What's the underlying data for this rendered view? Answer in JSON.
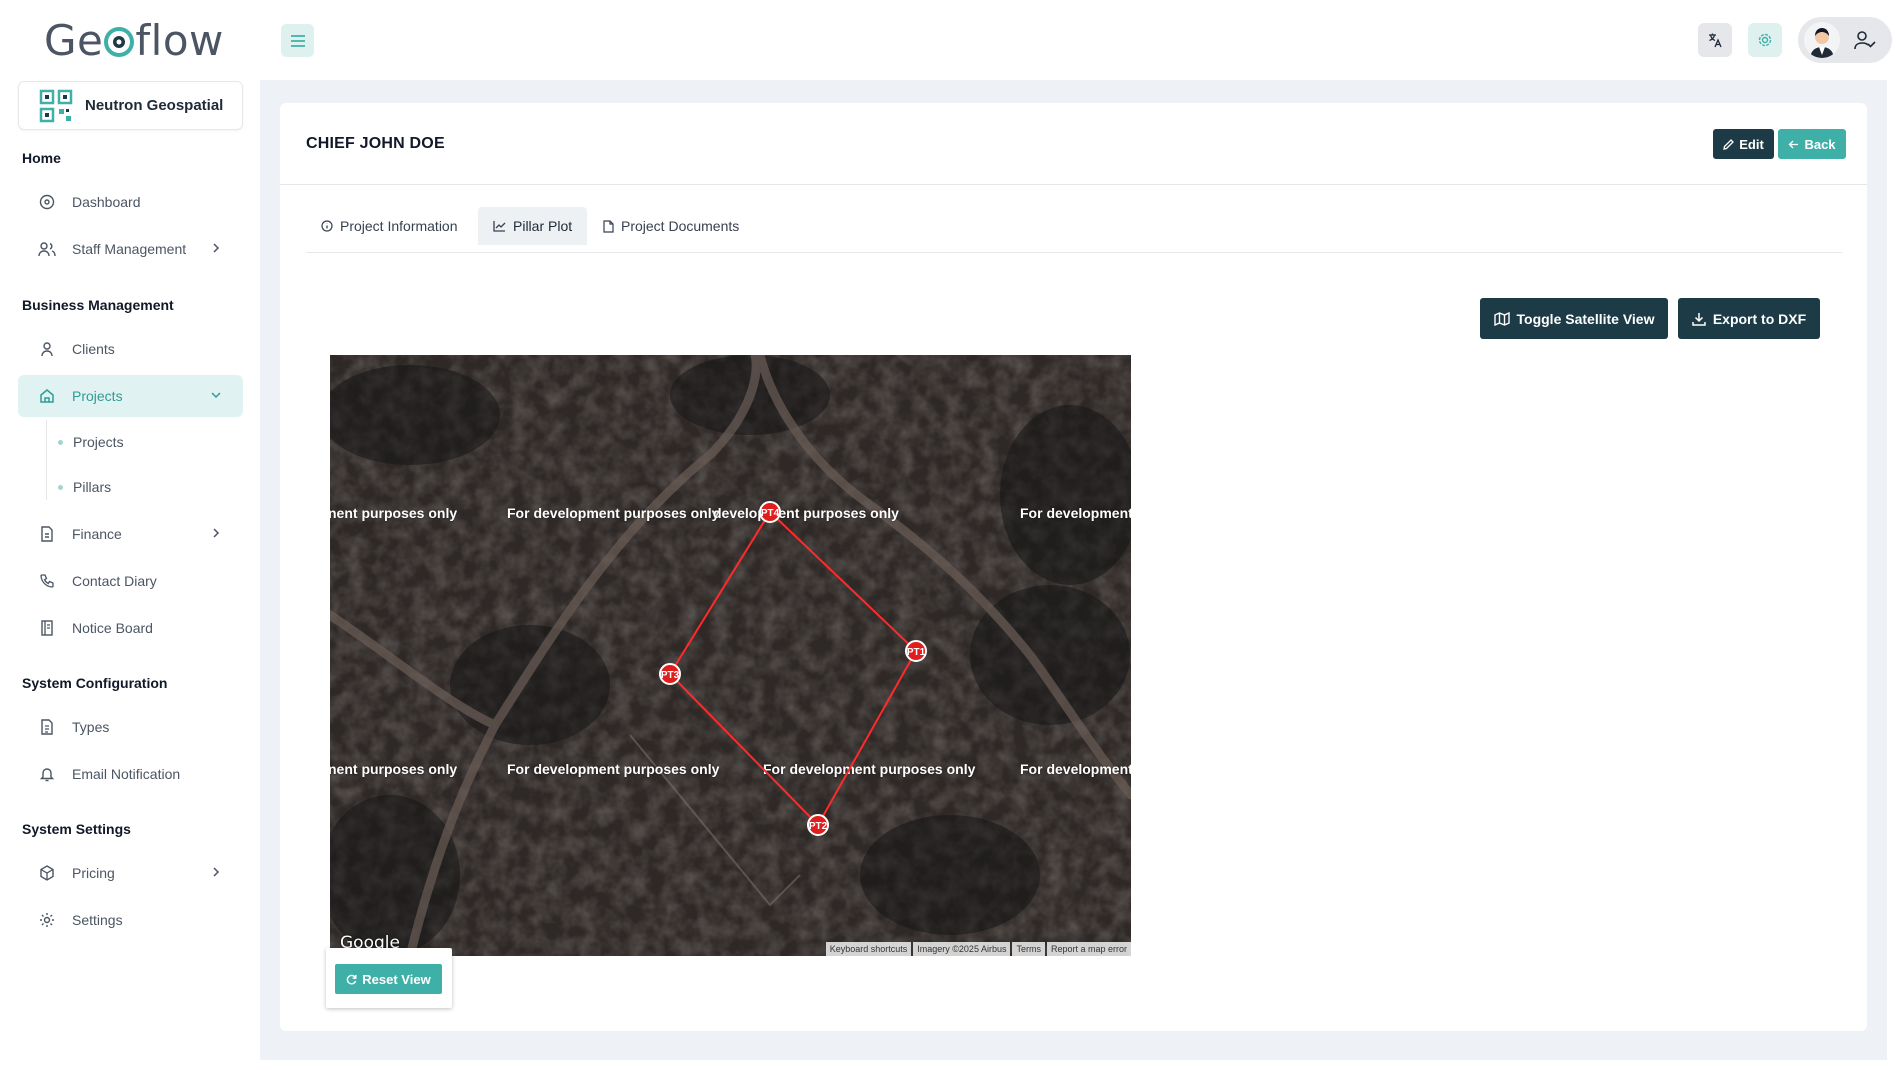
{
  "app": {
    "logo_text_1": "Ge",
    "logo_text_2": "flow"
  },
  "organization": {
    "name": "Neutron Geospatial"
  },
  "sidebar": {
    "sections": {
      "home": "Home",
      "business": "Business Management",
      "system_config": "System Configuration",
      "system_settings": "System Settings"
    },
    "items": {
      "dashboard": "Dashboard",
      "staff": "Staff Management",
      "clients": "Clients",
      "projects": "Projects",
      "projects_sub": "Projects",
      "pillars_sub": "Pillars",
      "finance": "Finance",
      "contact_diary": "Contact Diary",
      "notice_board": "Notice Board",
      "types": "Types",
      "email_notification": "Email Notification",
      "pricing": "Pricing",
      "settings": "Settings"
    }
  },
  "page": {
    "title": "CHIEF JOHN DOE",
    "edit_label": "Edit",
    "back_label": "Back",
    "tabs": {
      "info": "Project Information",
      "pillar": "Pillar Plot",
      "docs": "Project Documents"
    },
    "toggle_satellite": "Toggle Satellite View",
    "export_dxf": "Export to DXF",
    "reset_view": "Reset View"
  },
  "map": {
    "watermarks": {
      "r1a": "nent purposes only",
      "r1b": "For development purposes only",
      "r1c": "development purposes only",
      "r1d": "For development p",
      "r2a": "nent purposes only",
      "r2b": "For development purposes only",
      "r2c": "For development purposes only",
      "r2d": "For development p"
    },
    "pillars": {
      "pt1": "PT1",
      "pt2": "PT2",
      "pt3": "PT3",
      "pt4": "PT4"
    },
    "google": "Google",
    "attribution": {
      "shortcuts": "Keyboard shortcuts",
      "imagery": "Imagery ©2025 Airbus",
      "terms": "Terms",
      "report": "Report a map error"
    },
    "polygon_color": "#ff2a2a"
  },
  "colors": {
    "accent": "#3fb0a8",
    "dark": "#1d3b47"
  }
}
